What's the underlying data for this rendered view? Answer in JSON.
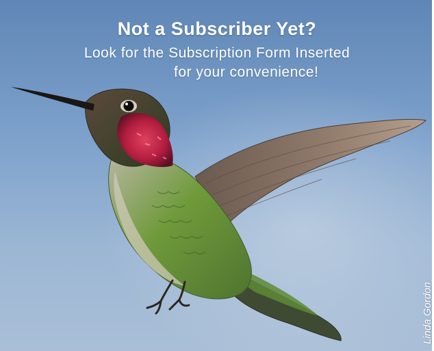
{
  "headline": "Not a Subscriber Yet?",
  "subline_1": "Look for the Subscription Form Inserted",
  "subline_2": "for your convenience!",
  "photo_credit": "Linda Gordon",
  "colors": {
    "sky_top": "#5f86b6",
    "sky_bottom": "#aabfd7",
    "text": "#ffffff",
    "gorget": "#c4264a",
    "back_green": "#6f9a3a"
  }
}
